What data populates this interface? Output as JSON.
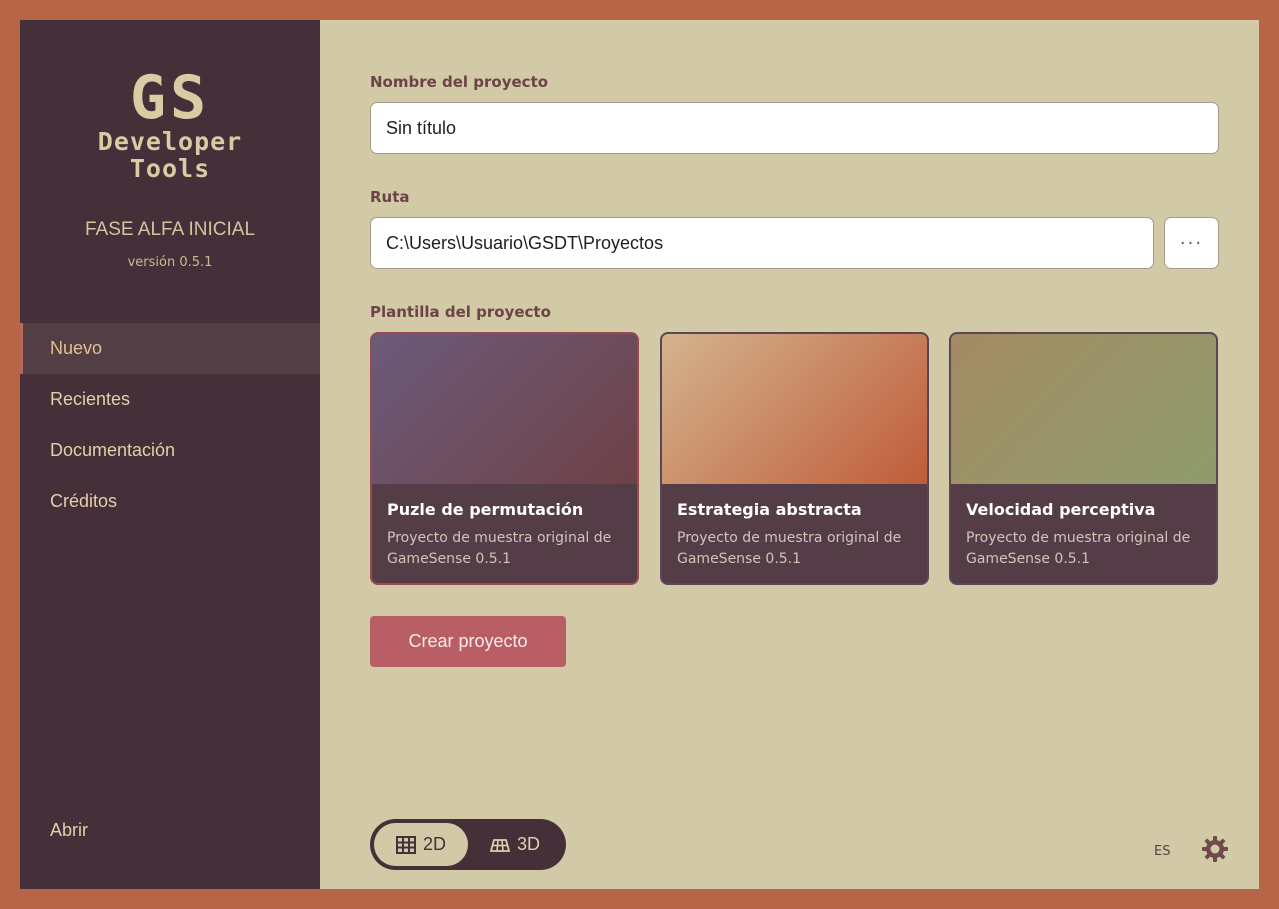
{
  "sidebar": {
    "logo_line1": "GS",
    "logo_line2": "Developer",
    "logo_line3": "Tools",
    "phase": "FASE ALFA INICIAL",
    "version": "versión 0.5.1",
    "nav": [
      {
        "label": "Nuevo",
        "active": true
      },
      {
        "label": "Recientes",
        "active": false
      },
      {
        "label": "Documentación",
        "active": false
      },
      {
        "label": "Créditos",
        "active": false
      }
    ],
    "open_label": "Abrir"
  },
  "form": {
    "name_label": "Nombre del proyecto",
    "name_value": "Sin título",
    "path_label": "Ruta",
    "path_value": "C:\\Users\\Usuario\\GSDT\\Proyectos",
    "browse_label": "···",
    "template_label": "Plantilla del proyecto"
  },
  "templates": [
    {
      "title": "Puzle de permutación",
      "desc": "Proyecto de muestra original de GameSense 0.5.1",
      "selected": true,
      "colors": [
        "#6c5b7b",
        "#6e4147"
      ]
    },
    {
      "title": "Estrategia abstracta",
      "desc": "Proyecto de muestra original de GameSense 0.5.1",
      "selected": false,
      "colors": [
        "#d3b48e",
        "#c05c3a"
      ]
    },
    {
      "title": "Velocidad perceptiva",
      "desc": "Proyecto de muestra original de GameSense 0.5.1",
      "selected": false,
      "colors": [
        "#a48b64",
        "#8e9b6c"
      ]
    }
  ],
  "create_label": "Crear proyecto",
  "mode_toggle": {
    "option_2d": "2D",
    "option_3d": "3D",
    "selected": "2D"
  },
  "language": "ES",
  "colors": {
    "accent": "#b85e64",
    "sidebar": "#452f38",
    "main_bg": "#d2c9a6",
    "frame": "#b86446"
  }
}
